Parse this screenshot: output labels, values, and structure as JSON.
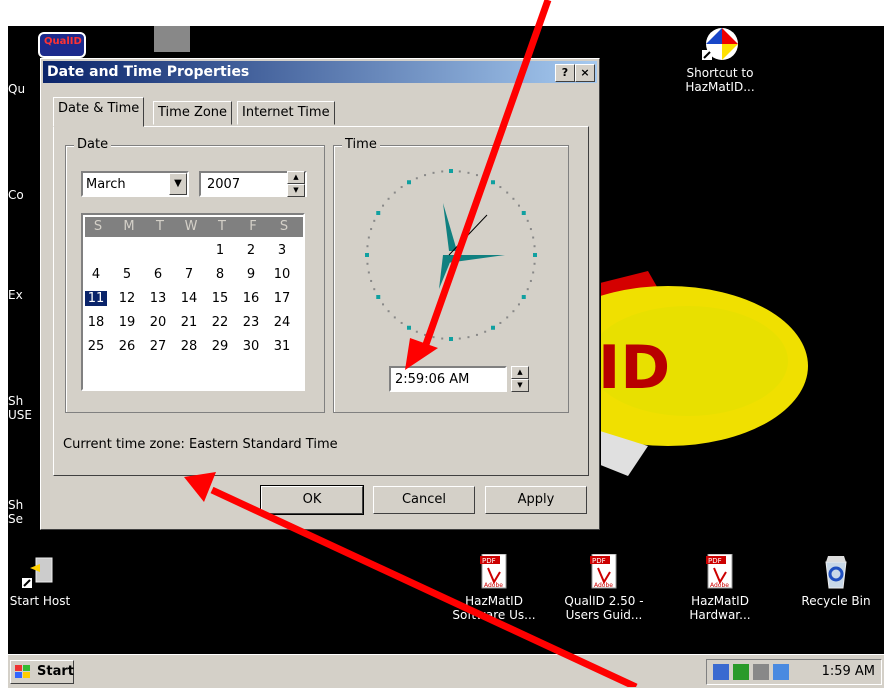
{
  "desktop": {
    "icons": {
      "hazmatid_shortcut": [
        "Shortcut to",
        "HazMatID..."
      ],
      "start_host": "Start Host",
      "hazmatid_software": [
        "HazMatID",
        "Software Us..."
      ],
      "qualid_guide": [
        "QualID 2.50 -",
        "Users Guid..."
      ],
      "hazmatid_hardware": [
        "HazMatID",
        "Hardwar..."
      ],
      "recycle_bin": "Recycle Bin",
      "qualid_logo": "QualID"
    },
    "left_labels": [
      "Qu",
      "Co",
      "Ex",
      "Sh",
      "USE",
      "Sh",
      "Se"
    ],
    "logo_text": "ID",
    "pdf_badge": "PDF",
    "adobe_label": "Adobe"
  },
  "dialog": {
    "title": "Date and Time Properties",
    "help_btn": "?",
    "close_btn": "×",
    "tabs": [
      "Date & Time",
      "Time Zone",
      "Internet Time"
    ],
    "date_group": "Date",
    "time_group": "Time",
    "month": "March",
    "year": "2007",
    "weekdays": [
      "S",
      "M",
      "T",
      "W",
      "T",
      "F",
      "S"
    ],
    "calendar_rows": [
      [
        "",
        "",
        "",
        "",
        "1",
        "2",
        "3"
      ],
      [
        "4",
        "5",
        "6",
        "7",
        "8",
        "9",
        "10"
      ],
      [
        "11",
        "12",
        "13",
        "14",
        "15",
        "16",
        "17"
      ],
      [
        "18",
        "19",
        "20",
        "21",
        "22",
        "23",
        "24"
      ],
      [
        "25",
        "26",
        "27",
        "28",
        "29",
        "30",
        "31"
      ]
    ],
    "selected_day": "11",
    "time_value": "2:59:06 AM",
    "timezone": "Current time zone:  Eastern Standard Time",
    "buttons": {
      "ok": "OK",
      "cancel": "Cancel",
      "apply": "Apply"
    }
  },
  "taskbar": {
    "start": "Start",
    "clock": "1:59 AM"
  },
  "colors": {
    "titlebar": "#0a246a",
    "arrow": "#ff0000",
    "dialog_face": "#d4d0c8"
  }
}
